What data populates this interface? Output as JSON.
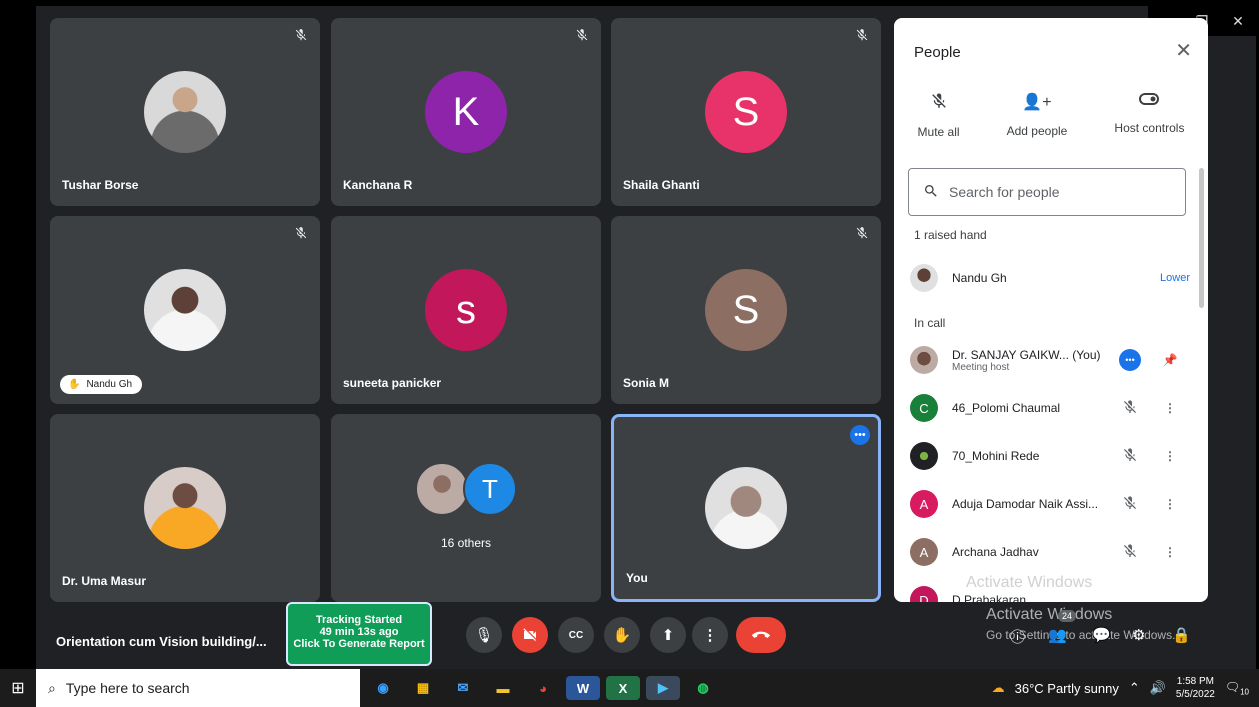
{
  "window": {
    "minimize": "—",
    "restore": "❐",
    "close": "✕"
  },
  "tiles": [
    {
      "name": "Tushar Borse"
    },
    {
      "name": "Kanchana R",
      "initial": "K",
      "color": "#8e24aa"
    },
    {
      "name": "Shaila Ghanti",
      "initial": "S",
      "color": "#e8336a"
    },
    {
      "hand_label": "Nandu Gh"
    },
    {
      "name": "suneeta panicker",
      "initial": "s",
      "color": "#c2185b"
    },
    {
      "name": "Sonia M",
      "initial": "S",
      "color": "#8d6e63"
    },
    {
      "name": "Dr. Uma Masur"
    },
    {
      "others_label": "16 others",
      "initial": "T",
      "color": "#1e88e5"
    },
    {
      "name": "You"
    }
  ],
  "people_panel": {
    "title": "People",
    "actions": [
      "Mute all",
      "Add people",
      "Host controls"
    ],
    "search_placeholder": "Search for people",
    "raised_section": "1 raised hand",
    "raised": {
      "name": "Nandu Gh",
      "action": "Lower"
    },
    "in_call_section": "In call",
    "host": {
      "name": "Dr. SANJAY GAIKW...",
      "you": "(You)",
      "role": "Meeting host"
    },
    "participants": [
      {
        "initial": "C",
        "name": "46_Polomi Chaumal",
        "color": "#188038"
      },
      {
        "initial": "",
        "name": "70_Mohini Rede",
        "color": "#202124"
      },
      {
        "initial": "A",
        "name": "Aduja Damodar Naik Assi...",
        "color": "#d81b60"
      },
      {
        "initial": "A",
        "name": "Archana Jadhav",
        "color": "#8d6e63"
      },
      {
        "initial": "D",
        "name": "D Prabakaran",
        "color": "#c2185b"
      }
    ]
  },
  "watermark": {
    "line1": "Activate Windows",
    "line2": "Go to Settings to activate Windows."
  },
  "bottom_bar": {
    "meeting_title": "Orientation cum Vision building/...",
    "tracking": [
      "Tracking Started",
      "49 min 13s ago",
      "Click To Generate Report"
    ],
    "people_count": "24"
  },
  "taskbar": {
    "search_placeholder": "Type here to search",
    "weather": "36°C  Partly sunny",
    "time": "1:58 PM",
    "date": "5/5/2022",
    "notifications": "10"
  }
}
